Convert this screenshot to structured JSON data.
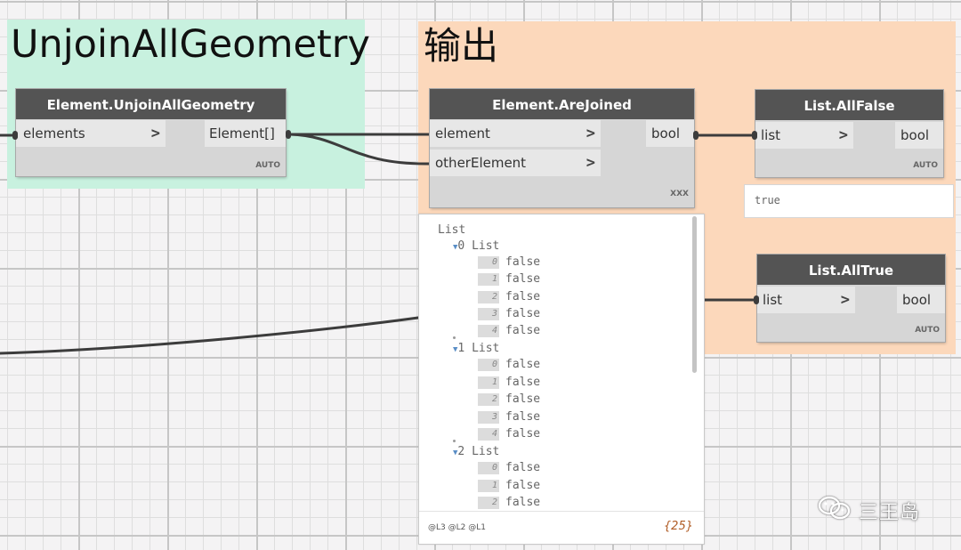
{
  "groups": [
    {
      "title": "UnjoinAllGeometry",
      "color": "#c8f1df"
    },
    {
      "title": "输出",
      "color": "#fcd8bb"
    }
  ],
  "nodes": {
    "unjoin": {
      "title": "Element.UnjoinAllGeometry",
      "inputs": [
        "elements"
      ],
      "output": "Element[]",
      "lacing": "AUTO"
    },
    "arejoined": {
      "title": "Element.AreJoined",
      "inputs": [
        "element",
        "otherElement"
      ],
      "output": "bool",
      "lacing": "XXX"
    },
    "allfalse": {
      "title": "List.AllFalse",
      "inputs": [
        "list"
      ],
      "output": "bool",
      "lacing": "AUTO",
      "preview": "true"
    },
    "alltrue": {
      "title": "List.AllTrue",
      "inputs": [
        "list"
      ],
      "output": "bool",
      "lacing": "AUTO"
    }
  },
  "watch": {
    "root": "List",
    "lists": [
      {
        "label": "0 List",
        "items": [
          [
            "0",
            "false"
          ],
          [
            "1",
            "false"
          ],
          [
            "2",
            "false"
          ],
          [
            "3",
            "false"
          ],
          [
            "4",
            "false"
          ]
        ]
      },
      {
        "label": "1 List",
        "items": [
          [
            "0",
            "false"
          ],
          [
            "1",
            "false"
          ],
          [
            "2",
            "false"
          ],
          [
            "3",
            "false"
          ],
          [
            "4",
            "false"
          ]
        ]
      },
      {
        "label": "2 List",
        "items": [
          [
            "0",
            "false"
          ],
          [
            "1",
            "false"
          ],
          [
            "2",
            "false"
          ]
        ]
      }
    ],
    "levels": "@L3 @L2 @L1",
    "count": "{25}"
  },
  "watermark": {
    "text": "三王岛",
    "icon": "wechat-icon"
  },
  "colors": {
    "node_header": "#545454",
    "wire": "#3c3c3c",
    "group_green": "#c8f1df",
    "group_orange": "#fcd8bb"
  }
}
